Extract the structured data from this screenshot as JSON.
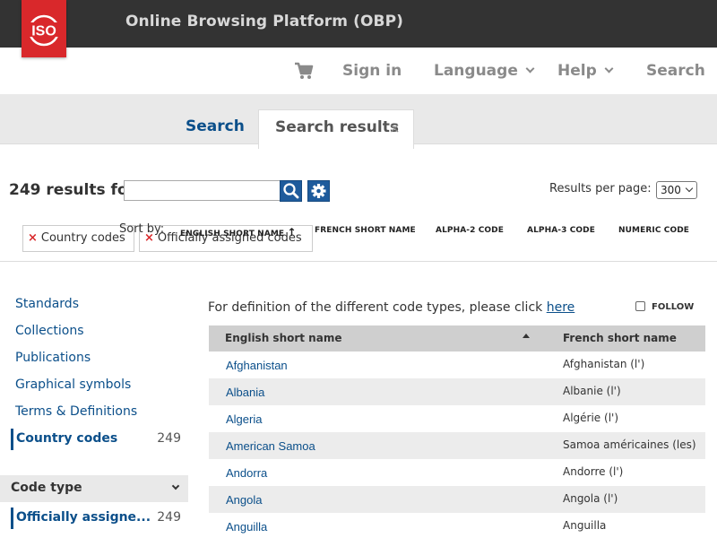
{
  "header": {
    "logo_text": "ISO",
    "app_title": "Online Browsing Platform (OBP)"
  },
  "nav": {
    "cart_icon": "shopping-cart-icon",
    "sign_in": "Sign in",
    "language": "Language",
    "help": "Help",
    "search": "Search"
  },
  "tabs": {
    "search": "Search",
    "results": "Search results",
    "close": "×"
  },
  "results": {
    "count_label": "249 results for",
    "search_value": "",
    "per_page_label": "Results per page:",
    "per_page_value": "300"
  },
  "filters": [
    {
      "label": "Country codes"
    },
    {
      "label": "Officially assigned codes"
    }
  ],
  "sort": {
    "label": "Sort by:",
    "columns": [
      "ENGLISH SHORT NAME",
      "FRENCH SHORT NAME",
      "ALPHA-2 CODE",
      "ALPHA-3 CODE",
      "NUMERIC CODE"
    ],
    "active_indicator": "↑"
  },
  "sidebar": {
    "items": [
      "Standards",
      "Collections",
      "Publications",
      "Graphical symbols",
      "Terms & Definitions"
    ],
    "active": {
      "label": "Country codes",
      "count": "249"
    },
    "facet": {
      "title": "Code type",
      "item": "Officially assigne...",
      "count": "249"
    }
  },
  "main": {
    "definition_text": "For definition of the different code types, please click ",
    "definition_link": "here",
    "follow": "FOLLOW",
    "table": {
      "headers": [
        "English short name",
        "French short name"
      ],
      "rows": [
        {
          "en": "Afghanistan",
          "fr": "Afghanistan (l')"
        },
        {
          "en": "Albania",
          "fr": "Albanie (l')"
        },
        {
          "en": "Algeria",
          "fr": "Algérie (l')"
        },
        {
          "en": "American Samoa",
          "fr": "Samoa américaines (les)"
        },
        {
          "en": "Andorra",
          "fr": "Andorre (l')"
        },
        {
          "en": "Angola",
          "fr": "Angola (l')"
        },
        {
          "en": "Anguilla",
          "fr": "Anguilla"
        }
      ]
    }
  },
  "colors": {
    "brand_red": "#d9282b",
    "topbar": "#333333",
    "link_blue": "#0b4f8a"
  }
}
